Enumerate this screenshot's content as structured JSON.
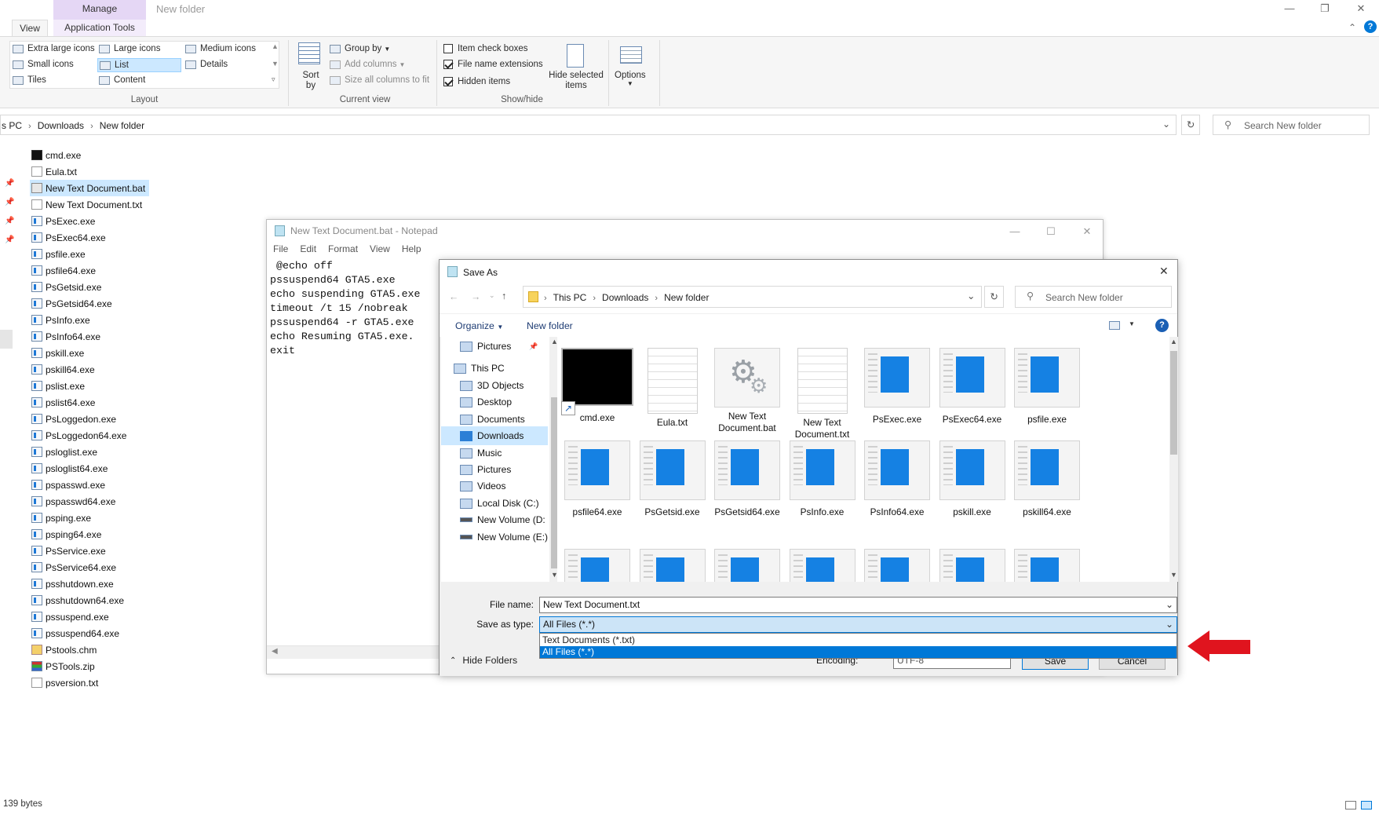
{
  "explorer": {
    "manage_tab": "Manage",
    "window_title": "New folder",
    "tabs": [
      "View",
      "Application Tools"
    ],
    "layout_options": [
      "Extra large icons",
      "Large icons",
      "Medium icons",
      "Small icons",
      "List",
      "Details",
      "Tiles",
      "Content"
    ],
    "group_labels": {
      "layout": "Layout",
      "current_view": "Current view",
      "show_hide": "Show/hide"
    },
    "current_view": {
      "sort_by": "Sort by",
      "group_by": "Group by",
      "add_columns": "Add columns",
      "size_all": "Size all columns to fit"
    },
    "show_hide": {
      "item_check_boxes": "Item check boxes",
      "file_name_extensions": "File name extensions",
      "hidden_items": "Hidden items",
      "hide_selected": "Hide selected items",
      "options": "Options"
    },
    "checks": {
      "item_check_boxes": false,
      "file_name_extensions": true,
      "hidden_items": true
    },
    "breadcrumb": [
      "s PC",
      "Downloads",
      "New folder"
    ],
    "search_placeholder": "Search New folder",
    "files": [
      "cmd.exe",
      "Eula.txt",
      "New Text Document.bat",
      "New Text Document.txt",
      "PsExec.exe",
      "PsExec64.exe",
      "psfile.exe",
      "psfile64.exe",
      "PsGetsid.exe",
      "PsGetsid64.exe",
      "PsInfo.exe",
      "PsInfo64.exe",
      "pskill.exe",
      "pskill64.exe",
      "pslist.exe",
      "pslist64.exe",
      "PsLoggedon.exe",
      "PsLoggedon64.exe",
      "psloglist.exe",
      "psloglist64.exe",
      "pspasswd.exe",
      "pspasswd64.exe",
      "psping.exe",
      "psping64.exe",
      "PsService.exe",
      "PsService64.exe",
      "psshutdown.exe",
      "psshutdown64.exe",
      "pssuspend.exe",
      "pssuspend64.exe",
      "Pstools.chm",
      "PSTools.zip",
      "psversion.txt"
    ],
    "selected_file": "New Text Document.bat",
    "status": "139 bytes"
  },
  "notepad": {
    "title": "New Text Document.bat - Notepad",
    "menu": [
      "File",
      "Edit",
      "Format",
      "View",
      "Help"
    ],
    "lines": [
      " @echo off",
      "pssuspend64 GTA5.exe",
      "echo suspending GTA5.exe",
      "timeout /t 15 /nobreak",
      "pssuspend64 -r GTA5.exe",
      "echo Resuming GTA5.exe.",
      "exit"
    ]
  },
  "saveas": {
    "title": "Save As",
    "breadcrumb": [
      "This PC",
      "Downloads",
      "New folder"
    ],
    "search_placeholder": "Search New folder",
    "organize": "Organize",
    "new_folder": "New folder",
    "nav": [
      "Pictures",
      "This PC",
      "3D Objects",
      "Desktop",
      "Documents",
      "Downloads",
      "Music",
      "Pictures",
      "Videos",
      "Local Disk (C:)",
      "New Volume (D:",
      "New Volume (E:)"
    ],
    "nav_selected": "Downloads",
    "tiles": [
      {
        "label": "cmd.exe",
        "kind": "cmd"
      },
      {
        "label": "Eula.txt",
        "kind": "doc"
      },
      {
        "label": "New Text Document.bat",
        "kind": "gear"
      },
      {
        "label": "New Text Document.txt",
        "kind": "doc"
      },
      {
        "label": "PsExec.exe",
        "kind": "exe"
      },
      {
        "label": "PsExec64.exe",
        "kind": "exe"
      },
      {
        "label": "psfile.exe",
        "kind": "exe"
      },
      {
        "label": "psfile64.exe",
        "kind": "exe"
      },
      {
        "label": "PsGetsid.exe",
        "kind": "exe"
      },
      {
        "label": "PsGetsid64.exe",
        "kind": "exe"
      },
      {
        "label": "PsInfo.exe",
        "kind": "exe"
      },
      {
        "label": "PsInfo64.exe",
        "kind": "exe"
      },
      {
        "label": "pskill.exe",
        "kind": "exe"
      },
      {
        "label": "pskill64.exe",
        "kind": "exe"
      }
    ],
    "file_name_label": "File name:",
    "file_name_value": "New Text Document.txt",
    "save_as_type_label": "Save as type:",
    "save_as_type_value": "All Files  (*.*)",
    "type_options": [
      "Text Documents (*.txt)",
      "All Files  (*.*)"
    ],
    "encoding_label": "Encoding:",
    "encoding_value": "UTF-8",
    "save": "Save",
    "cancel": "Cancel",
    "hide_folders": "Hide Folders"
  },
  "colors": {
    "accent": "#0078d7",
    "manage_tab": "#e5d7f5",
    "arrow": "#e0141e"
  }
}
